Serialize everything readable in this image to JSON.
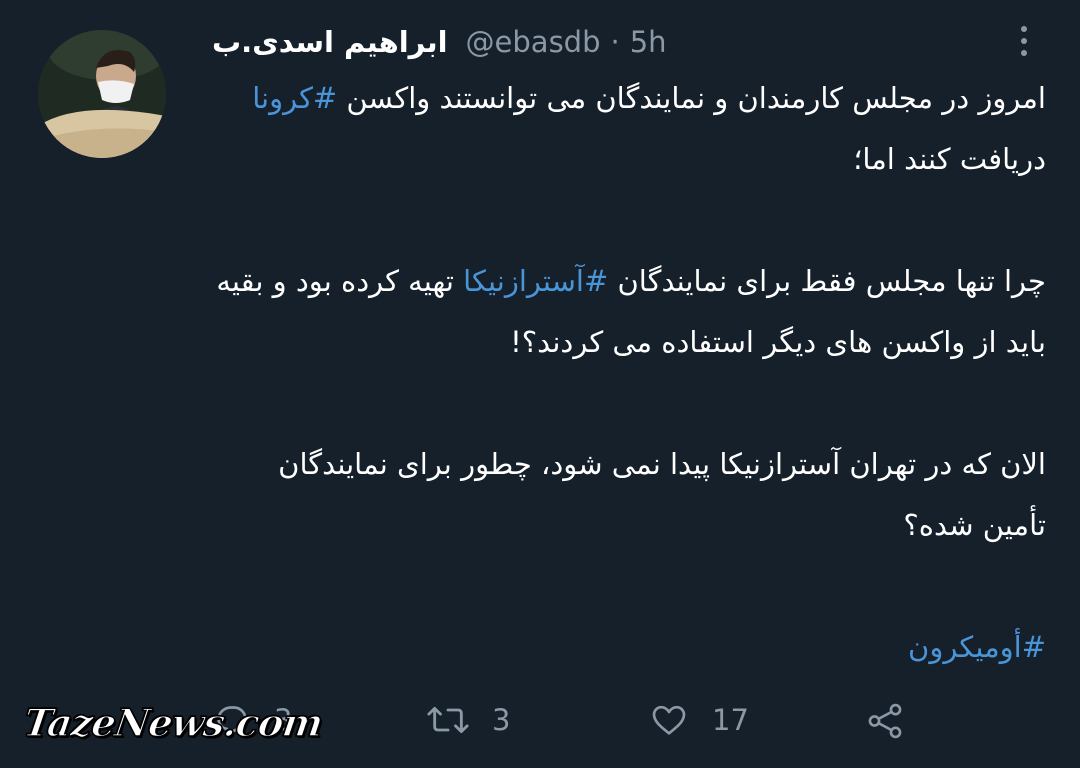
{
  "author": {
    "display_name": "ابراهیم اسدی.ب",
    "handle": "@ebasdb",
    "separator": "·",
    "time": "5h"
  },
  "tweet": {
    "p1_text": "امروز در مجلس کارمندان و نمایندگان می توانستند واکسن ",
    "p1_hashtag": "#کرونا",
    "p1_tail": " دریافت کنند اما؛",
    "p2_text": "چرا تنها مجلس فقط برای نمایندگان ",
    "p2_hashtag": "#آسترازنیکا",
    "p2_tail": " تهیه کرده بود و بقیه باید از واکسن های دیگر استفاده می کردند؟!",
    "p3_text": "الان که در تهران آسترازنیکا پیدا نمی شود، چطور برای نمایندگان تأمین شده؟",
    "p4_hashtag": "#أومیکرون"
  },
  "actions": {
    "reply_count": "3",
    "retweet_count": "3",
    "like_count": "17"
  },
  "watermark": "TazeNews.com",
  "icons": {
    "reply": "reply-icon",
    "retweet": "retweet-icon",
    "like": "heart-icon",
    "share": "share-icon",
    "more": "more-options-icon"
  },
  "colors": {
    "background": "#15202b",
    "hashtag": "#4a94d8",
    "muted": "#8b98a5"
  }
}
